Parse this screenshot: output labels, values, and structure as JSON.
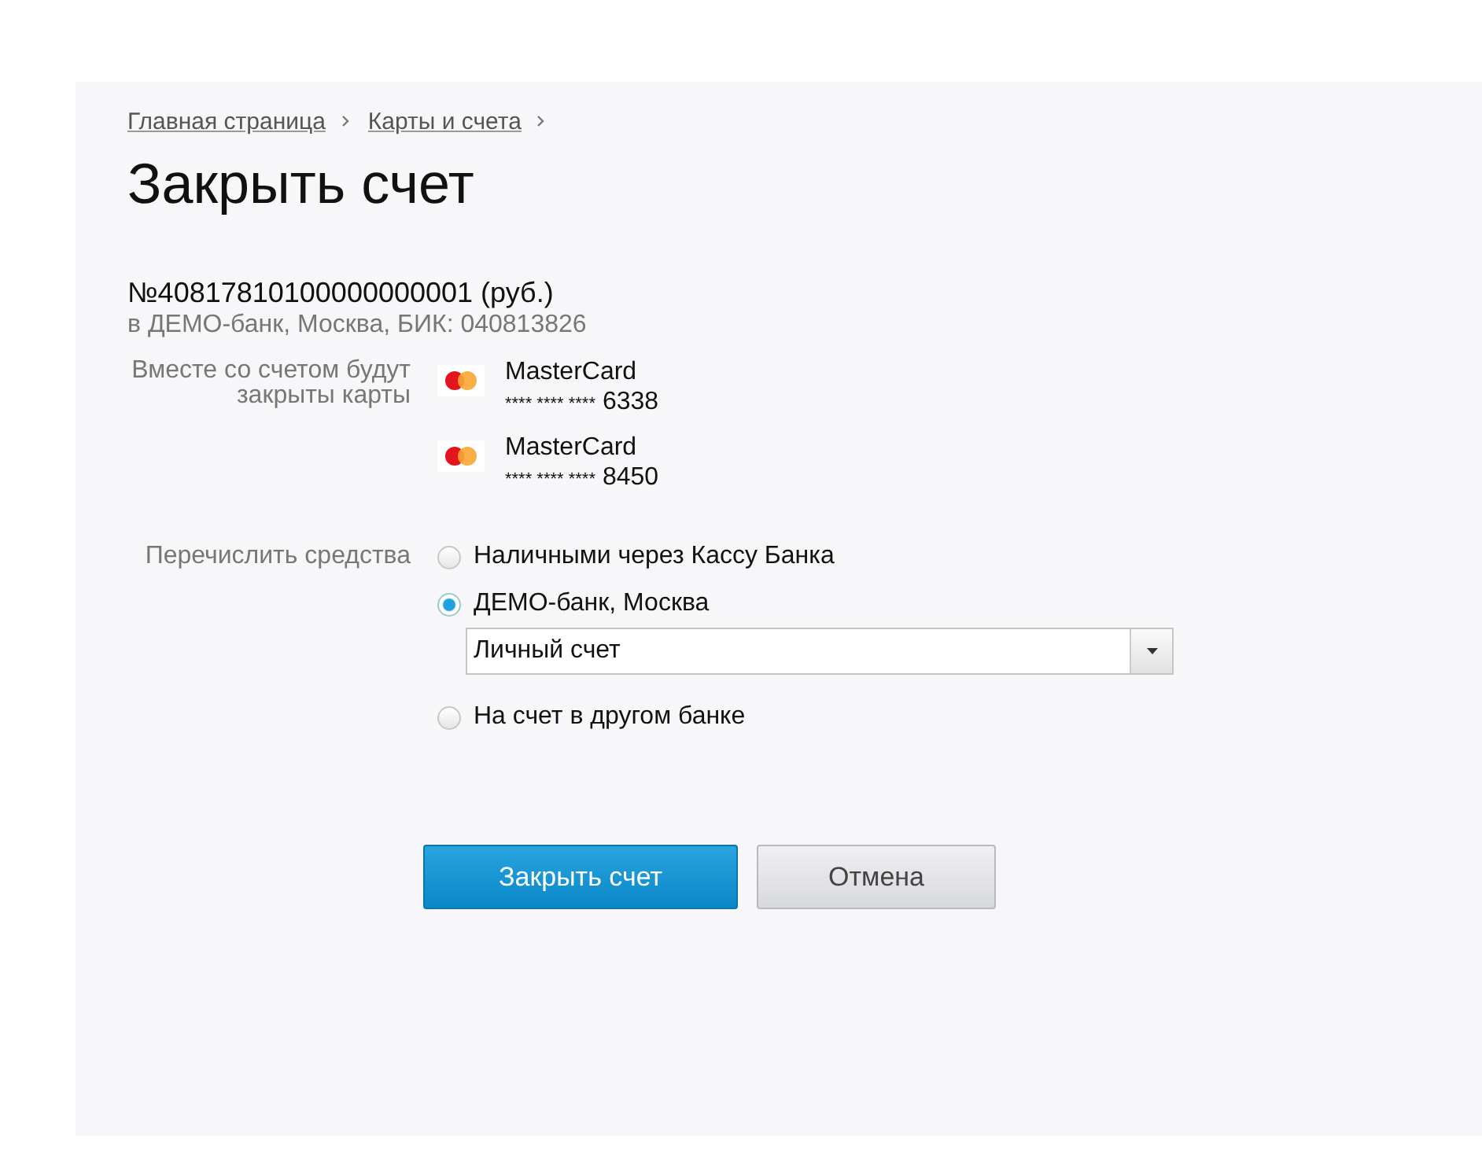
{
  "breadcrumbs": [
    {
      "label": "Главная страница"
    },
    {
      "label": "Карты и счета"
    }
  ],
  "title": "Закрыть счет",
  "account": {
    "number": "№40817810100000000001 (руб.)",
    "details": "в ДЕМО-банк, Москва, БИК: 040813826"
  },
  "cards_label": "Вместе со счетом будут закрыты карты",
  "cards": [
    {
      "brand": "MasterCard",
      "mask": "**** **** ****",
      "last4": "6338"
    },
    {
      "brand": "MasterCard",
      "mask": "**** **** ****",
      "last4": "8450"
    }
  ],
  "transfer_label": "Перечислить средства",
  "transfer_options": [
    {
      "label": "Наличными через Кассу Банка",
      "selected": false
    },
    {
      "label": "ДЕМО-банк, Москва",
      "selected": true,
      "dropdown": {
        "value": "Личный счет"
      }
    },
    {
      "label": "На счет в другом банке",
      "selected": false
    }
  ],
  "buttons": [
    {
      "label": "Закрыть счет",
      "kind": "primary"
    },
    {
      "label": "Отмена",
      "kind": "secondary"
    }
  ]
}
